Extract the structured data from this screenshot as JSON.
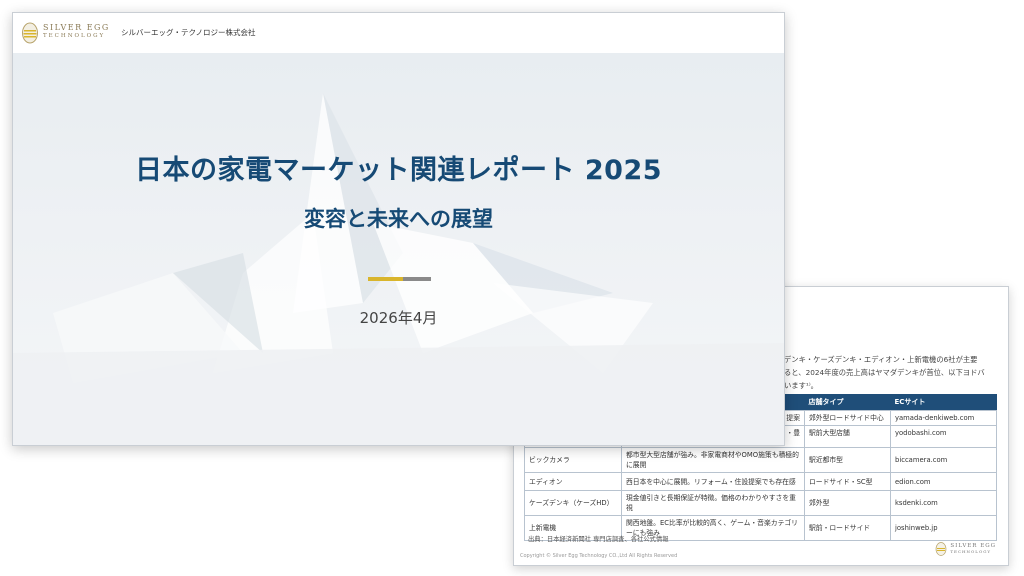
{
  "front": {
    "company": "シルバーエッグ・テクノロジー株式会社",
    "brand_line1": "SILVER EGG",
    "brand_line2": "TECHNOLOGY",
    "title": "日本の家電マーケット関連レポート 2025",
    "subtitle": "変容と未来への展望",
    "date": "2026年4月"
  },
  "back": {
    "intro_lines": [
      "デンキ・ケーズデンキ・エディオン・上新電機の6社が主要",
      "ると、2024年度の売上高はヤマダデンキが首位、以下ヨドバ",
      "います¹⁾。"
    ],
    "table": {
      "headers": [
        "",
        "",
        "店舗タイプ",
        "ECサイト"
      ],
      "rows": [
        [
          "",
          "提案",
          "郊外型ロードサイド中心",
          "yamada-denkiweb.com"
        ],
        [
          "",
          "・豊",
          "駅前大型店舗",
          "yodobashi.com"
        ],
        [
          "ビックカメラ",
          "都市型大型店舗が強み。非家電商材やOMO施策も積極的に展開",
          "駅近都市型",
          "biccamera.com"
        ],
        [
          "エディオン",
          "西日本を中心に展開。リフォーム・住設提案でも存在感",
          "ロードサイド・SC型",
          "edion.com"
        ],
        [
          "ケーズデンキ（ケーズHD）",
          "現金値引きと長期保証が特徴。価格のわかりやすさを重視",
          "郊外型",
          "ksdenki.com"
        ],
        [
          "上新電機",
          "関西地盤。EC比率が比較的高く、ゲーム・音楽カテゴリーにも強み",
          "駅前・ロードサイド",
          "joshinweb.jp"
        ]
      ]
    },
    "source": "出典：日本経済新聞社 専門店調査、各社公式情報",
    "copyright": "Copyright © Silver Egg Technology CO.,Ltd All Rights Reserved",
    "brand_line1": "SILVER EGG",
    "brand_line2": "TECHNOLOGY"
  },
  "colors": {
    "title": "#164a75",
    "table_header": "#1f4e79",
    "accent_gold": "#d9b52c",
    "accent_gray": "#8a8a8a"
  },
  "icons": [
    "silver-egg-logo-icon"
  ]
}
